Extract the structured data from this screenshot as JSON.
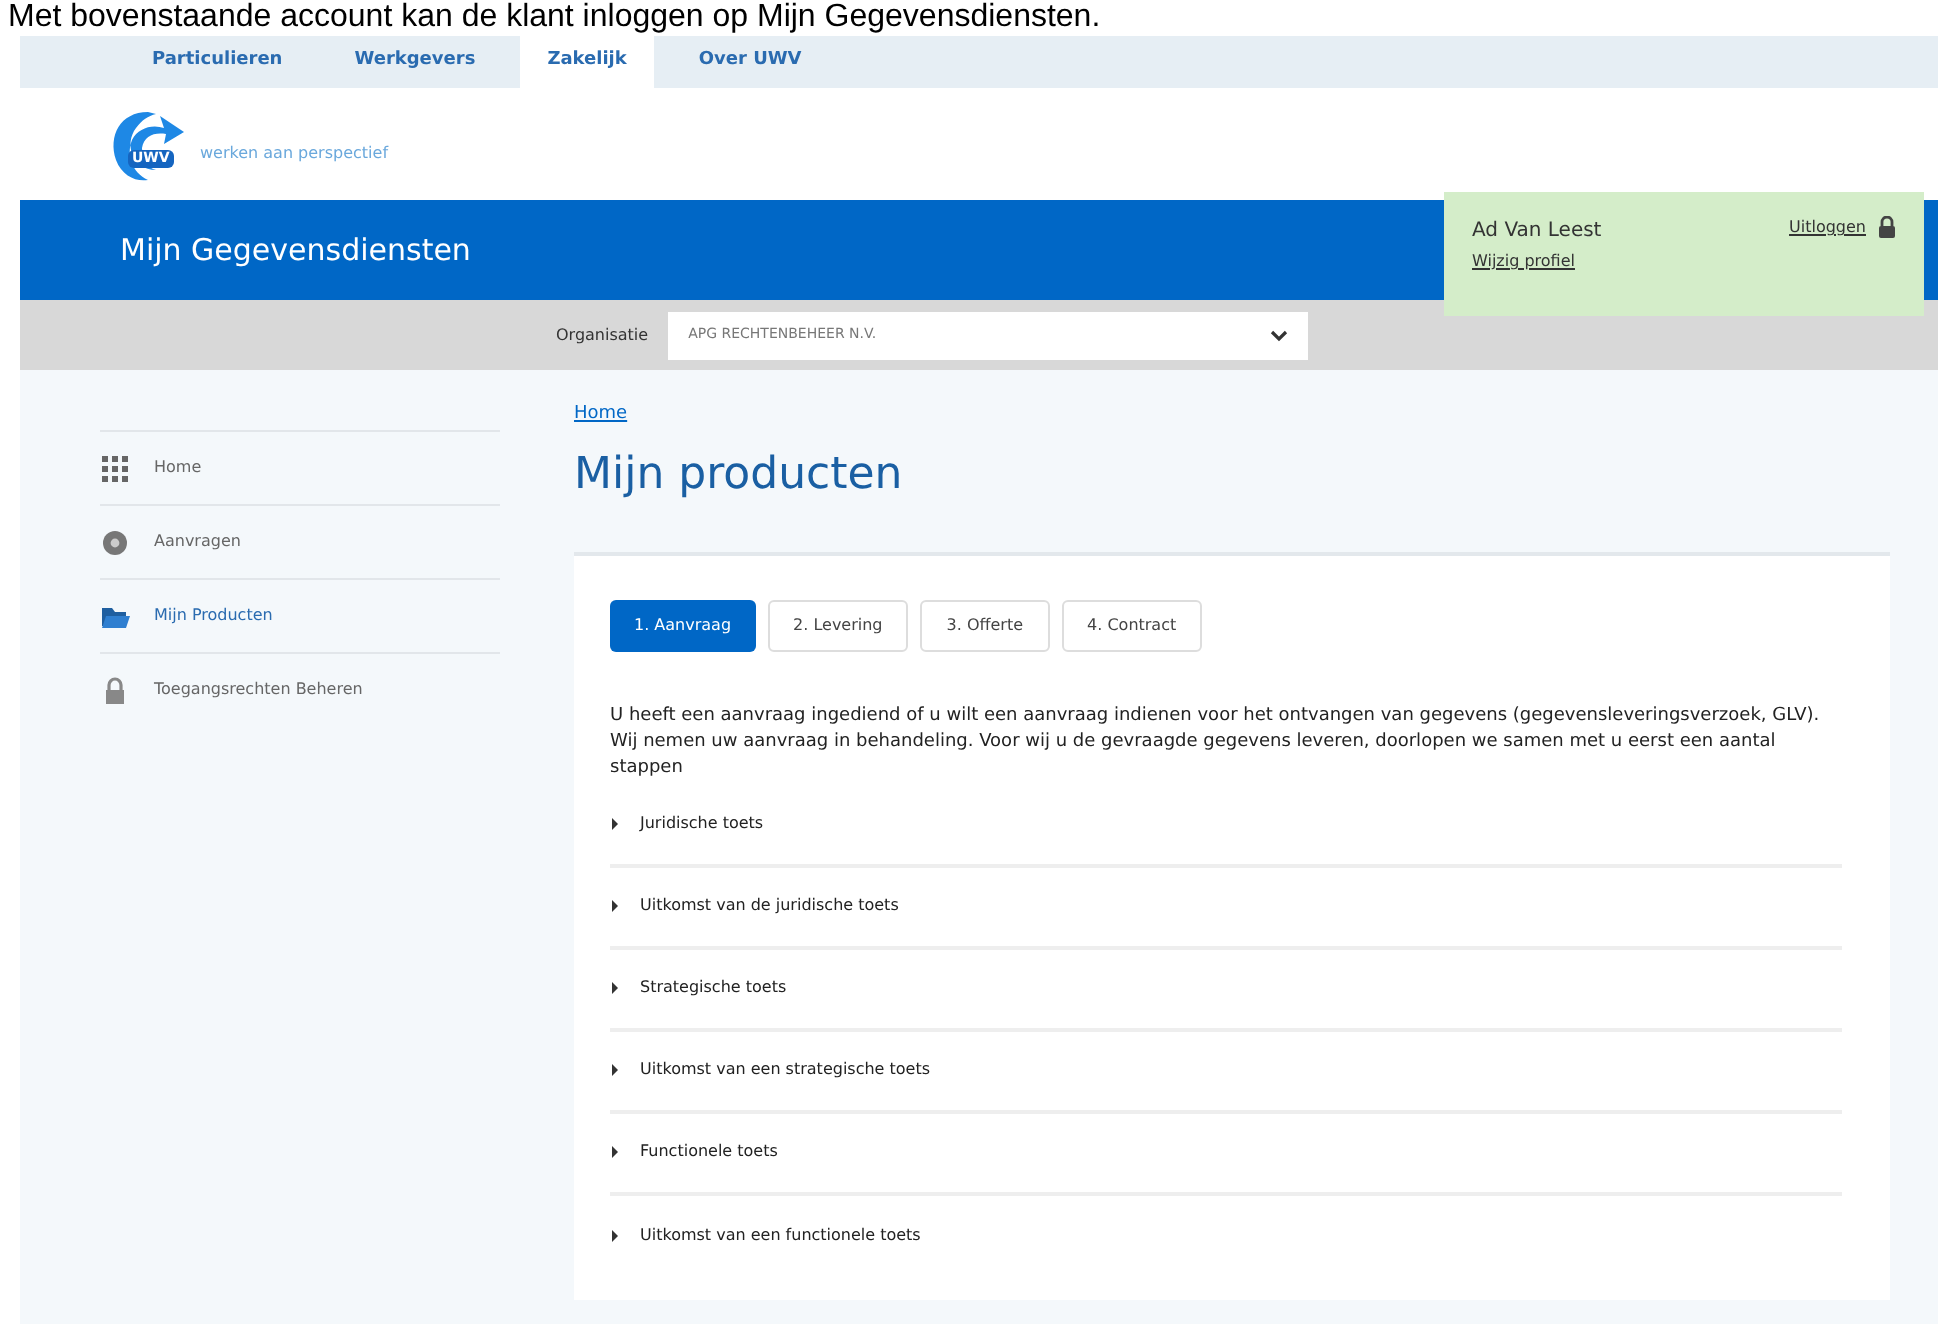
{
  "caption": "Met bovenstaande account kan de klant inloggen op Mijn Gegevensdiensten.",
  "top_nav": [
    {
      "label": "Particulieren",
      "selected": false
    },
    {
      "label": "Werkgevers",
      "selected": false
    },
    {
      "label": "Zakelijk",
      "selected": true
    },
    {
      "label": "Over UWV",
      "selected": false
    }
  ],
  "logo": {
    "mark": "UWV",
    "tagline": "werken aan perspectief"
  },
  "app_title": "Mijn Gegevensdiensten",
  "user_panel": {
    "name": "Ad Van Leest",
    "profile_link": "Wijzig profiel",
    "logout": "Uitloggen"
  },
  "organisation": {
    "label": "Organisatie",
    "value": "APG RECHTENBEHEER N.V."
  },
  "sidebar": [
    {
      "label": "Home",
      "kind": "grid",
      "selected": false
    },
    {
      "label": "Aanvragen",
      "kind": "circle",
      "selected": false
    },
    {
      "label": "Mijn Producten",
      "kind": "folder",
      "selected": true
    },
    {
      "label": "Toegangsrechten Beheren",
      "kind": "lock",
      "selected": false
    }
  ],
  "breadcrumb": "Home",
  "heading": "Mijn producten",
  "steps": [
    {
      "label": "1. Aanvraag",
      "selected": true
    },
    {
      "label": "2. Levering",
      "selected": false
    },
    {
      "label": "3. Offerte",
      "selected": false
    },
    {
      "label": "4. Contract",
      "selected": false
    }
  ],
  "intro": "U heeft een aanvraag ingediend of u wilt een aanvraag indienen voor het ontvangen van gegevens (gegevensleveringsverzoek, GLV). Wij nemen uw aanvraag in behandeling. Voor wij u de gevraagde gegevens leveren, doorlopen we samen met u eerst een aantal stappen",
  "sections": [
    {
      "label": "Juridische toets",
      "expanded": false
    },
    {
      "label": "Uitkomst van de juridische toets",
      "expanded": false
    },
    {
      "label": "Strategische toets",
      "expanded": false
    },
    {
      "label": "Uitkomst van een strategische toets",
      "expanded": false
    },
    {
      "label": "Functionele toets",
      "expanded": false
    },
    {
      "label": "Uitkomst van een functionele toets",
      "expanded": false
    }
  ]
}
